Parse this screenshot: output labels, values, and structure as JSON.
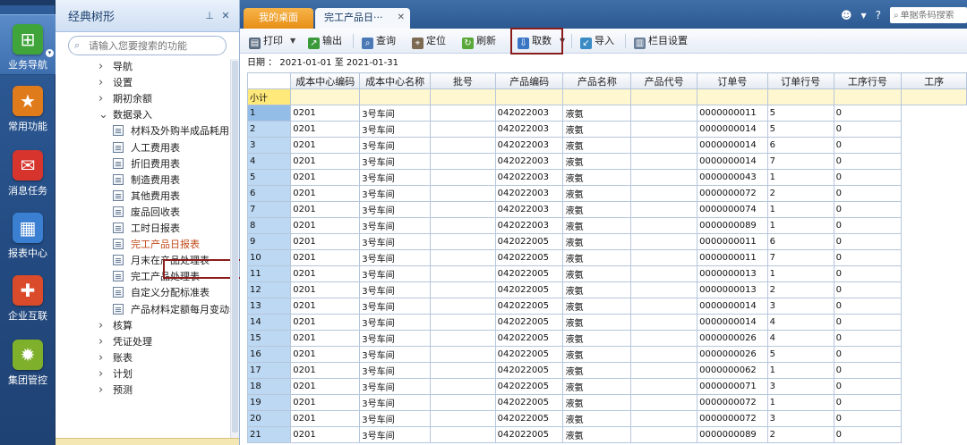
{
  "rail": {
    "items": [
      {
        "label": "业务导航",
        "icon": "org-chart-icon",
        "color": "#3fa53a"
      },
      {
        "label": "常用功能",
        "icon": "star-icon",
        "color": "#e07b1c"
      },
      {
        "label": "消息任务",
        "icon": "mail-icon",
        "color": "#d6342c"
      },
      {
        "label": "报表中心",
        "icon": "report-icon",
        "color": "#3a7fd1"
      },
      {
        "label": "企业互联",
        "icon": "connect-icon",
        "color": "#d94b2a"
      },
      {
        "label": "集团管控",
        "icon": "gear-cluster-icon",
        "color": "#7fb02c"
      }
    ]
  },
  "tree": {
    "title": "经典树形",
    "search_placeholder": "请输入您要搜索的功能",
    "nodes": [
      {
        "label": "导航",
        "type": "folder",
        "open": false
      },
      {
        "label": "设置",
        "type": "folder",
        "open": false
      },
      {
        "label": "期初余额",
        "type": "folder",
        "open": false
      },
      {
        "label": "数据录入",
        "type": "folder",
        "open": true
      },
      {
        "label": "材料及外购半成品耗用",
        "type": "doc"
      },
      {
        "label": "人工费用表",
        "type": "doc"
      },
      {
        "label": "折旧费用表",
        "type": "doc"
      },
      {
        "label": "制造费用表",
        "type": "doc"
      },
      {
        "label": "其他费用表",
        "type": "doc"
      },
      {
        "label": "废品回收表",
        "type": "doc"
      },
      {
        "label": "工时日报表",
        "type": "doc"
      },
      {
        "label": "完工产品日报表",
        "type": "doc",
        "selected": true
      },
      {
        "label": "月末在产品处理表",
        "type": "doc"
      },
      {
        "label": "完工产品处理表",
        "type": "doc"
      },
      {
        "label": "自定义分配标准表",
        "type": "doc"
      },
      {
        "label": "产品材料定额每月变动表",
        "type": "doc"
      },
      {
        "label": "核算",
        "type": "folder",
        "open": false
      },
      {
        "label": "凭证处理",
        "type": "folder",
        "open": false
      },
      {
        "label": "账表",
        "type": "folder",
        "open": false
      },
      {
        "label": "计划",
        "type": "folder",
        "open": false
      },
      {
        "label": "预测",
        "type": "folder",
        "open": false
      }
    ]
  },
  "tabs": {
    "home": "我的桌面",
    "report": "完工产品日···"
  },
  "header": {
    "barcode_placeholder": "单据条码搜索"
  },
  "toolbar": {
    "print": "打印",
    "export": "输出",
    "query": "查询",
    "locate": "定位",
    "refresh": "刷新",
    "fetch": "取数",
    "import": "导入",
    "columns": "栏目设置"
  },
  "filter": {
    "date_label": "日期 ：",
    "date_from": "2021-01-01",
    "to_label": "至",
    "date_to": "2021-01-31"
  },
  "grid": {
    "columns": [
      "成本中心编码",
      "成本中心名称",
      "批号",
      "产品编码",
      "产品名称",
      "产品代号",
      "订单号",
      "订单行号",
      "工序行号",
      "工序"
    ],
    "subtotal_label": "小计",
    "rows": [
      [
        "1",
        "0201",
        "3号车间",
        "",
        "042022003",
        "液氨",
        "",
        "0000000011",
        "5",
        "0"
      ],
      [
        "2",
        "0201",
        "3号车间",
        "",
        "042022003",
        "液氨",
        "",
        "0000000014",
        "5",
        "0"
      ],
      [
        "3",
        "0201",
        "3号车间",
        "",
        "042022003",
        "液氨",
        "",
        "0000000014",
        "6",
        "0"
      ],
      [
        "4",
        "0201",
        "3号车间",
        "",
        "042022003",
        "液氨",
        "",
        "0000000014",
        "7",
        "0"
      ],
      [
        "5",
        "0201",
        "3号车间",
        "",
        "042022003",
        "液氨",
        "",
        "0000000043",
        "1",
        "0"
      ],
      [
        "6",
        "0201",
        "3号车间",
        "",
        "042022003",
        "液氨",
        "",
        "0000000072",
        "2",
        "0"
      ],
      [
        "7",
        "0201",
        "3号车间",
        "",
        "042022003",
        "液氨",
        "",
        "0000000074",
        "1",
        "0"
      ],
      [
        "8",
        "0201",
        "3号车间",
        "",
        "042022003",
        "液氨",
        "",
        "0000000089",
        "1",
        "0"
      ],
      [
        "9",
        "0201",
        "3号车间",
        "",
        "042022005",
        "液氨",
        "",
        "0000000011",
        "6",
        "0"
      ],
      [
        "10",
        "0201",
        "3号车间",
        "",
        "042022005",
        "液氨",
        "",
        "0000000011",
        "7",
        "0"
      ],
      [
        "11",
        "0201",
        "3号车间",
        "",
        "042022005",
        "液氨",
        "",
        "0000000013",
        "1",
        "0"
      ],
      [
        "12",
        "0201",
        "3号车间",
        "",
        "042022005",
        "液氨",
        "",
        "0000000013",
        "2",
        "0"
      ],
      [
        "13",
        "0201",
        "3号车间",
        "",
        "042022005",
        "液氨",
        "",
        "0000000014",
        "3",
        "0"
      ],
      [
        "14",
        "0201",
        "3号车间",
        "",
        "042022005",
        "液氨",
        "",
        "0000000014",
        "4",
        "0"
      ],
      [
        "15",
        "0201",
        "3号车间",
        "",
        "042022005",
        "液氨",
        "",
        "0000000026",
        "4",
        "0"
      ],
      [
        "16",
        "0201",
        "3号车间",
        "",
        "042022005",
        "液氨",
        "",
        "0000000026",
        "5",
        "0"
      ],
      [
        "17",
        "0201",
        "3号车间",
        "",
        "042022005",
        "液氨",
        "",
        "0000000062",
        "1",
        "0"
      ],
      [
        "18",
        "0201",
        "3号车间",
        "",
        "042022005",
        "液氨",
        "",
        "0000000071",
        "3",
        "0"
      ],
      [
        "19",
        "0201",
        "3号车间",
        "",
        "042022005",
        "液氨",
        "",
        "0000000072",
        "1",
        "0"
      ],
      [
        "20",
        "0201",
        "3号车间",
        "",
        "042022005",
        "液氨",
        "",
        "0000000072",
        "3",
        "0"
      ],
      [
        "21",
        "0201",
        "3号车间",
        "",
        "042022005",
        "液氨",
        "",
        "0000000089",
        "2",
        "0"
      ]
    ]
  }
}
